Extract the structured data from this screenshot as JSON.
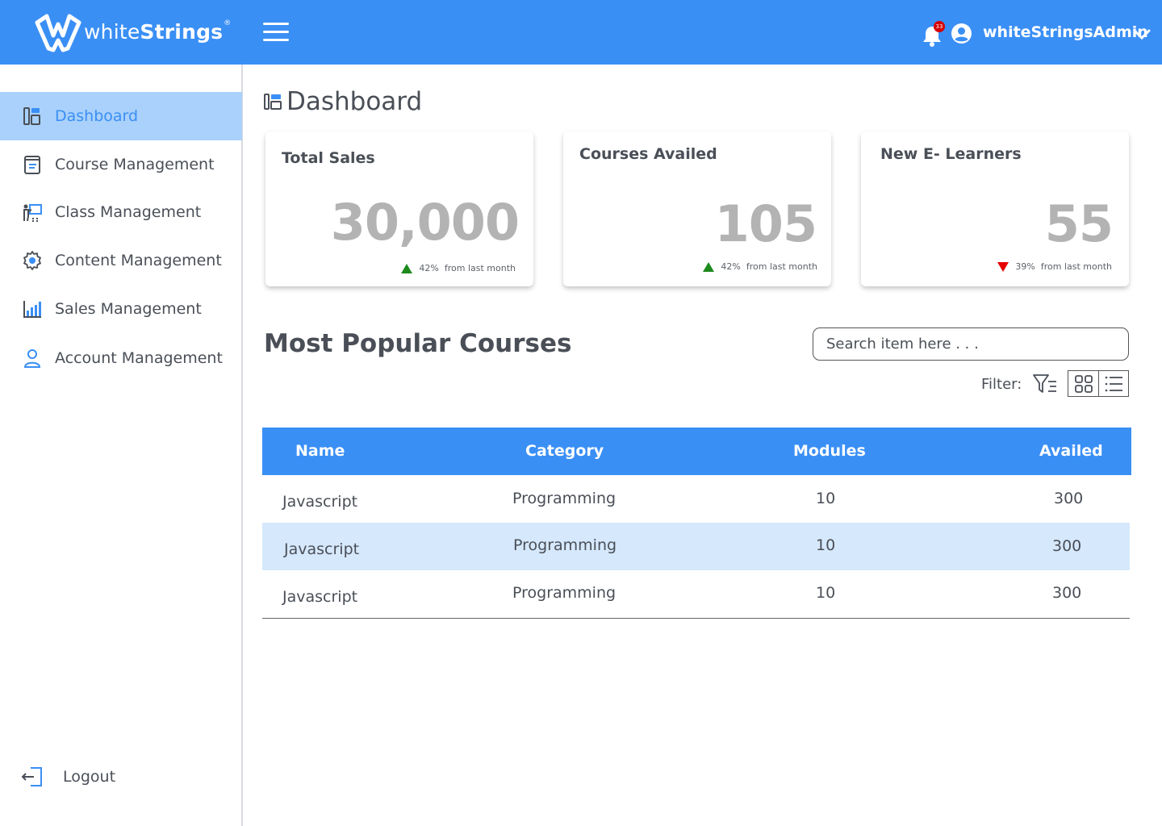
{
  "brand": {
    "name_light": "white",
    "name_bold": "Strings",
    "reg": "®"
  },
  "header": {
    "notification_count": "33",
    "username": "whiteStringsAdmin"
  },
  "sidebar": {
    "items": [
      {
        "label": "Dashboard",
        "icon": "dashboard-icon",
        "active": true
      },
      {
        "label": "Course Management",
        "icon": "book-icon"
      },
      {
        "label": "Class Management",
        "icon": "presentation-icon"
      },
      {
        "label": "Content Management",
        "icon": "gear-icon"
      },
      {
        "label": "Sales Management",
        "icon": "bar-chart-icon"
      },
      {
        "label": "Account Management",
        "icon": "user-icon"
      }
    ],
    "logout_label": "Logout"
  },
  "page": {
    "title": "Dashboard"
  },
  "cards": [
    {
      "title": "Total Sales",
      "value": "30,000",
      "trend": "up",
      "pct": "42%",
      "note": "from last month"
    },
    {
      "title": "Courses Availed",
      "value": "105",
      "trend": "up",
      "pct": "42%",
      "note": "from last month"
    },
    {
      "title": "New E- Learners",
      "value": "55",
      "trend": "down",
      "pct": "39%",
      "note": "from last month"
    }
  ],
  "popular": {
    "title": "Most Popular Courses",
    "search_placeholder": "Search item here . . .",
    "filter_label": "Filter:",
    "columns": [
      "Name",
      "Category",
      "Modules",
      "Availed"
    ],
    "rows": [
      {
        "name": "Javascript",
        "category": "Programming",
        "modules": "10",
        "availed": "300"
      },
      {
        "name": "Javascript",
        "category": "Programming",
        "modules": "10",
        "availed": "300"
      },
      {
        "name": "Javascript",
        "category": "Programming",
        "modules": "10",
        "availed": "300"
      }
    ]
  },
  "colors": {
    "primary": "#3a8ff5",
    "active_bg": "#a9d1fb",
    "alt_row": "#d6e8fc",
    "up": "#1e8a1e",
    "down": "#e60000"
  }
}
